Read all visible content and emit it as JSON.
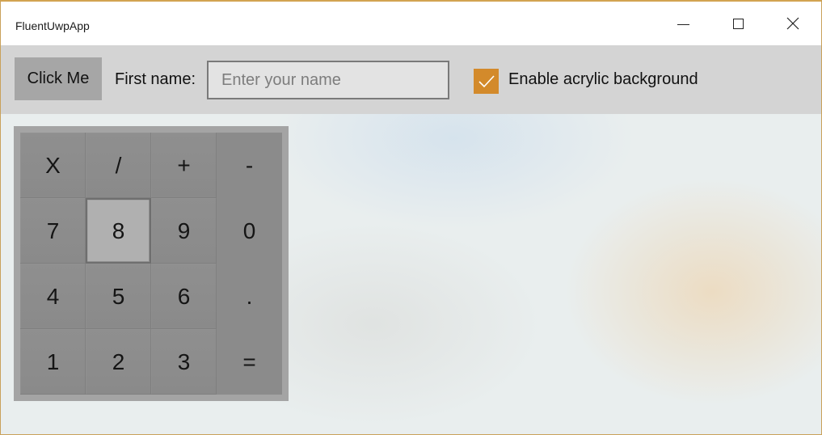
{
  "window": {
    "title": "FluentUwpApp"
  },
  "caption_buttons": {
    "minimize_icon": "minimize-icon",
    "maximize_icon": "maximize-icon",
    "close_icon": "close-icon",
    "close_glyph": "✕"
  },
  "toolbar": {
    "click_button_label": "Click Me",
    "first_name_label": "First name:",
    "name_input_placeholder": "Enter your name",
    "name_input_value": "",
    "acrylic_checkbox_label": "Enable acrylic background",
    "acrylic_checked": true,
    "accent_color": "#d38a2b"
  },
  "keypad": {
    "keys": [
      "X",
      "/",
      "+",
      "-",
      "7",
      "8",
      "9",
      "0",
      "4",
      "5",
      "6",
      ".",
      "1",
      "2",
      "3",
      "="
    ],
    "pressed_key": "8"
  }
}
